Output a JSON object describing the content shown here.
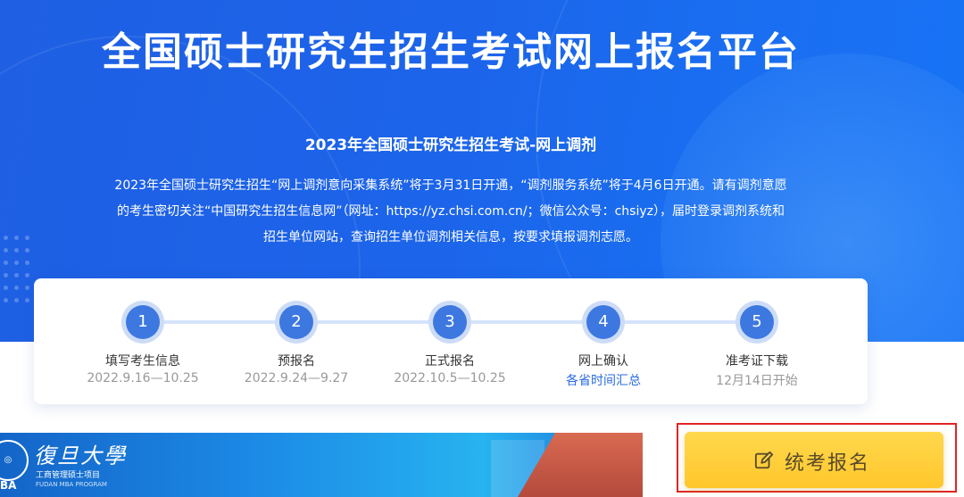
{
  "hero": {
    "title": "全国硕士研究生招生考试网上报名平台",
    "subtitle": "2023年全国硕士研究生招生考试-网上调剂",
    "desc_line1": "2023年全国硕士研究生招生“网上调剂意向采集系统”将于3月31日开通，“调剂服务系统”将于4月6日开通。请有调剂意愿",
    "desc_line2": "的考生密切关注“中国研究生招生信息网”（网址：https://yz.chsi.com.cn/；微信公众号：chsiyz），届时登录调剂系统和",
    "desc_line3": "招生单位网站，查询招生单位调剂相关信息，按要求填报调剂志愿。"
  },
  "steps": [
    {
      "number": "1",
      "name": "填写考生信息",
      "date": "2022.9.16—10.25"
    },
    {
      "number": "2",
      "name": "预报名",
      "date": "2022.9.24—9.27"
    },
    {
      "number": "3",
      "name": "正式报名",
      "date": "2022.10.5—10.25"
    },
    {
      "number": "4",
      "name": "网上确认",
      "date": "各省时间汇总"
    },
    {
      "number": "5",
      "name": "准考证下载",
      "date": "12月14日开始"
    }
  ],
  "banner": {
    "logo_cn": "復旦大學",
    "logo_sub": "工商管理硕士项目",
    "logo_en": "FUDAN MBA PROGRAM",
    "logo_mba": "BA"
  },
  "register_button": {
    "label": "统考报名",
    "icon": "edit-icon"
  },
  "colors": {
    "hero_blue": "#1c64ea",
    "step_circle": "#3d78e0",
    "link_blue": "#2a6be0",
    "button_yellow": "#ffc72c",
    "highlight_red": "#e02424"
  }
}
